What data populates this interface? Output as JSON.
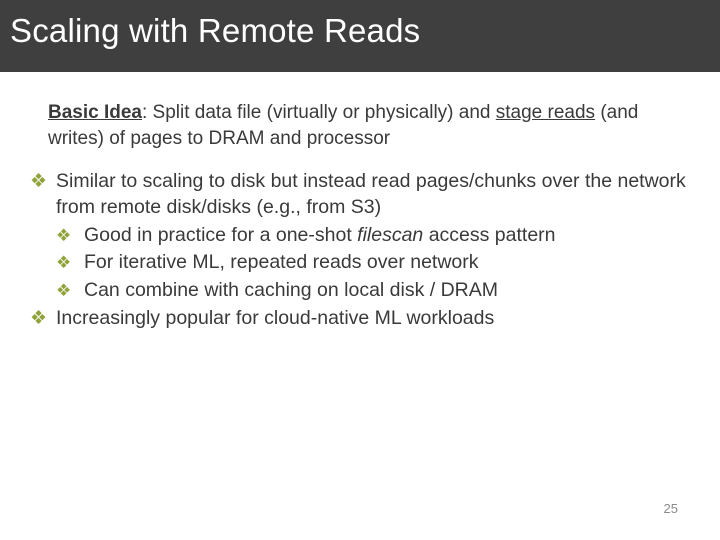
{
  "header": {
    "title": "Scaling with Remote Reads"
  },
  "intro": {
    "label": "Basic Idea",
    "rest1": ": Split data file (virtually or physically) and ",
    "u": "stage reads",
    "rest2": " (and writes) of pages to DRAM and processor"
  },
  "points": {
    "p1a": "Similar to scaling to disk but instead read pages/chunks over the network from remote disk/disks (e.g., from S3)",
    "p1s1a": "Good in practice for a one-shot ",
    "p1s1b": "filescan",
    "p1s1c": " access pattern",
    "p1s2": "For iterative ML, repeated reads over network",
    "p1s3": "Can combine with caching on local disk / DRAM",
    "p2": "Increasingly popular for cloud-native ML workloads"
  },
  "pagenum": "25"
}
